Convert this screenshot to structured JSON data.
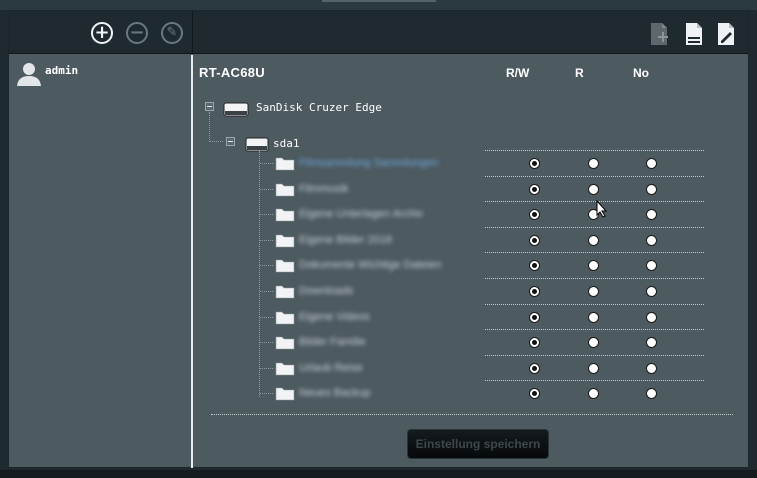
{
  "toolbar": {
    "left_icons": [
      "add-icon",
      "remove-icon",
      "edit-icon"
    ],
    "right_icons": [
      "folder-add-icon",
      "file-share-icon",
      "file-edit-icon"
    ]
  },
  "sidebar": {
    "users": [
      {
        "name": "admin",
        "icon": "user-icon"
      }
    ]
  },
  "main": {
    "router_name": "RT-AC68U",
    "columns": {
      "rw": "R/W",
      "r": "R",
      "no": "No"
    },
    "disk": {
      "name": "SanDisk Cruzer Edge",
      "partition": "sda1"
    },
    "folders": [
      {
        "name": "Filmsammlung Sammlungen",
        "permission": "rw"
      },
      {
        "name": "Filmmusik",
        "permission": "rw"
      },
      {
        "name": "Eigene Unterlagen Archiv",
        "permission": "rw"
      },
      {
        "name": "Eigene Bilder 2018",
        "permission": "rw"
      },
      {
        "name": "Dokumente Wichtige Dateien",
        "permission": "rw"
      },
      {
        "name": "Downloads",
        "permission": "rw"
      },
      {
        "name": "Eigene Videos",
        "permission": "rw"
      },
      {
        "name": "Bilder Familie",
        "permission": "rw"
      },
      {
        "name": "Urlaub Reise",
        "permission": "rw"
      },
      {
        "name": "Neues Backup",
        "permission": "rw"
      }
    ],
    "save_label": "Einstellung speichern"
  },
  "colors": {
    "panel": "#4d5a60",
    "toolbar": "#1f2a30",
    "link": "#6fa8dc"
  }
}
